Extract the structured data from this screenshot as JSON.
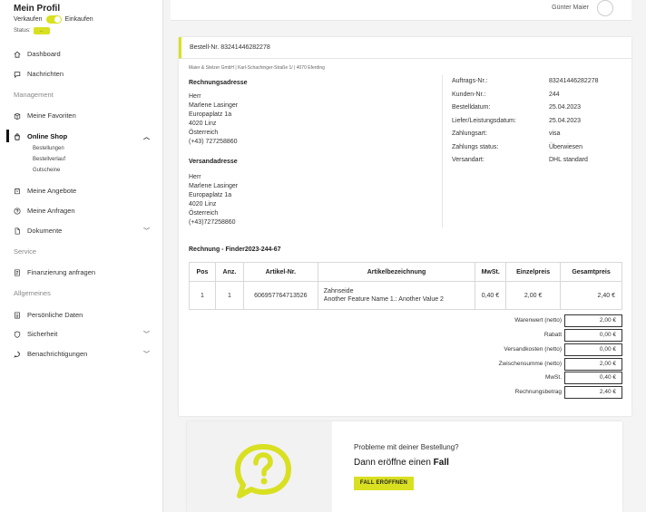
{
  "sidebar": {
    "profile_title": "Mein Profil",
    "mode_left": "Verkaufen",
    "mode_right": "Einkaufen",
    "status_label": "Status:",
    "status_value": "...",
    "items": [
      {
        "label": "Dashboard",
        "icon": "home-icon"
      },
      {
        "label": "Nachrichten",
        "icon": "chat-icon"
      },
      {
        "label": "Meine Favoriten",
        "icon": "box-icon"
      },
      {
        "label": "Online Shop",
        "icon": "bag-icon"
      },
      {
        "label": "Meine Angebote",
        "icon": "offer-icon"
      },
      {
        "label": "Meine Anfragen",
        "icon": "question-icon"
      },
      {
        "label": "Dokumente",
        "icon": "document-icon"
      },
      {
        "label": "Finanzierung anfragen",
        "icon": "finance-icon"
      },
      {
        "label": "Persönliche Daten",
        "icon": "profile-doc-icon"
      },
      {
        "label": "Sicherheit",
        "icon": "shield-icon"
      },
      {
        "label": "Benachrichtigungen",
        "icon": "bell-chat-icon"
      }
    ],
    "sections": [
      "Management",
      "Service",
      "Allgemeines"
    ],
    "sub_items": [
      "Bestellungen",
      "Bestellverlauf",
      "Gutscheine"
    ]
  },
  "topbar": {
    "user_name": "Günter Maier"
  },
  "order": {
    "title": "Bestell-Nr. 83241446282278",
    "seller_address": "Maier & Stelzer GmbH | Karl-Schachinger-Straße 1/ | 4070 Eferding",
    "billing_title": "Rechnungsadresse",
    "billing_lines": [
      "Herr",
      "Marlene Lasinger",
      "Europaplatz 1a",
      "4020 Linz",
      "Österreich",
      "(+43) 727258860"
    ],
    "shipping_title": "Versandadresse",
    "shipping_lines": [
      "Herr",
      "Marlene Lasinger",
      "Europaplatz 1a",
      "4020 Linz",
      "Österreich",
      "(+43)727258860"
    ],
    "info": [
      {
        "k": "Auftrags-Nr.:",
        "v": "83241446282278"
      },
      {
        "k": "Kunden-Nr.:",
        "v": "244"
      },
      {
        "k": "Bestelldatum:",
        "v": "25.04.2023"
      },
      {
        "k": "Liefer/Leistungsdatum:",
        "v": "25.04.2023"
      },
      {
        "k": "Zahlungsart:",
        "v": "visa"
      },
      {
        "k": "Zahlungs status:",
        "v": "Überwiesen"
      },
      {
        "k": "Versandart:",
        "v": "DHL standard"
      }
    ],
    "invoice_title": "Rechnung - Finder2023-244-67",
    "table": {
      "headers": [
        "Pos",
        "Anz.",
        "Artikel-Nr.",
        "Artikelbezeichnung",
        "MwSt.",
        "Einzelpreis",
        "Gesamtpreis"
      ],
      "rows": [
        {
          "pos": "1",
          "qty": "1",
          "sku": "606957764713526",
          "name": "Zahnseide",
          "feature": "Another Feature Name 1.: Another Value 2",
          "vat": "0,40 €",
          "unit": "2,00 €",
          "total": "2,40 €"
        }
      ]
    },
    "summary": [
      {
        "k": "Warenwert (netto)",
        "v": "2,00 €"
      },
      {
        "k": "Rabatt",
        "v": "0,00 €"
      },
      {
        "k": "Versandkosten (netto)",
        "v": "0,00 €"
      },
      {
        "k": "Zwischensumme (netto)",
        "v": "2,00 €"
      },
      {
        "k": "MwSt.",
        "v": "0,40 €"
      },
      {
        "k": "Rechnungsbetrag",
        "v": "2,40 €"
      }
    ]
  },
  "help": {
    "question": "Probleme mit deiner Bestellung?",
    "cta_prefix": "Dann eröffne einen ",
    "cta_bold": "Fall",
    "button": "FALL ERÖFFNEN"
  },
  "colors": {
    "accent": "#d9e021",
    "icon_accent": "#d9e021"
  }
}
